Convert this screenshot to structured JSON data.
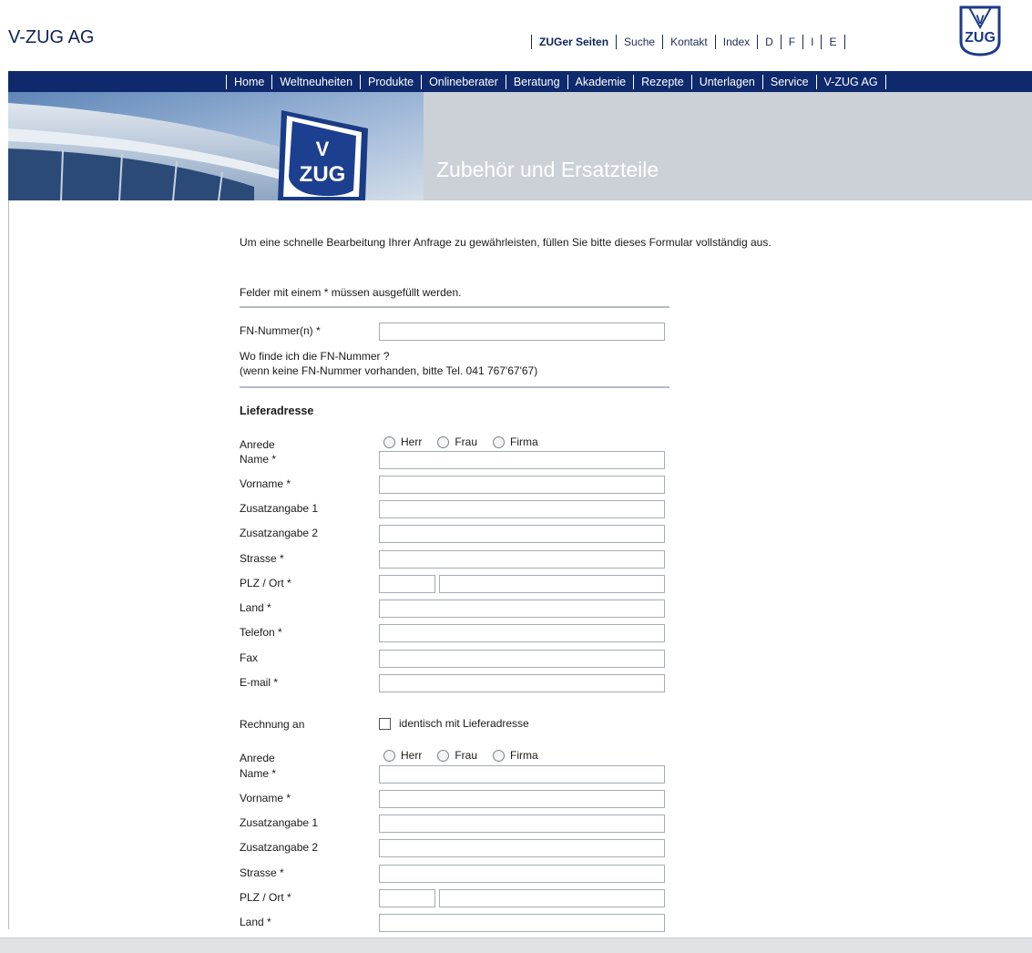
{
  "header": {
    "brand": "V-ZUG AG",
    "toplinks": [
      "ZUGer Seiten",
      "Suche",
      "Kontakt",
      "Index",
      "D",
      "F",
      "I",
      "E"
    ]
  },
  "nav": {
    "items": [
      "Home",
      "Weltneuheiten",
      "Produkte",
      "Onlineberater",
      "Beratung",
      "Akademie",
      "Rezepte",
      "Unterlagen",
      "Service",
      "V-ZUG AG"
    ]
  },
  "banner": {
    "title": "Zubehör und Ersatzteile"
  },
  "form": {
    "intro": "Um eine schnelle Bearbeitung Ihrer Anfrage zu gewährleisten, füllen Sie bitte dieses Formular vollständig aus.",
    "required_note": "Felder mit einem * müssen ausgefüllt werden.",
    "fn_label": "FN-Nummer(n) *",
    "fn_help_1": "Wo finde ich die FN-Nummer ?",
    "fn_help_2": "(wenn keine FN-Nummer vorhanden, bitte Tel. 041 767'67'67)",
    "delivery_title": "Lieferadresse",
    "anrede_label": "Anrede",
    "anrede_options": [
      "Herr",
      "Frau",
      "Firma"
    ],
    "labels": {
      "name": "Name *",
      "vorname": "Vorname *",
      "zusatz1": "Zusatzangabe 1",
      "zusatz2": "Zusatzangabe 2",
      "strasse": "Strasse *",
      "plzort": "PLZ / Ort *",
      "land": "Land *",
      "telefon": "Telefon *",
      "fax": "Fax",
      "email": "E-mail *"
    },
    "rechnung_label": "Rechnung an",
    "identisch_label": "identisch mit Lieferadresse"
  },
  "colors": {
    "brand_navy": "#0e2a6d",
    "banner_grey": "#ccd1d8"
  }
}
